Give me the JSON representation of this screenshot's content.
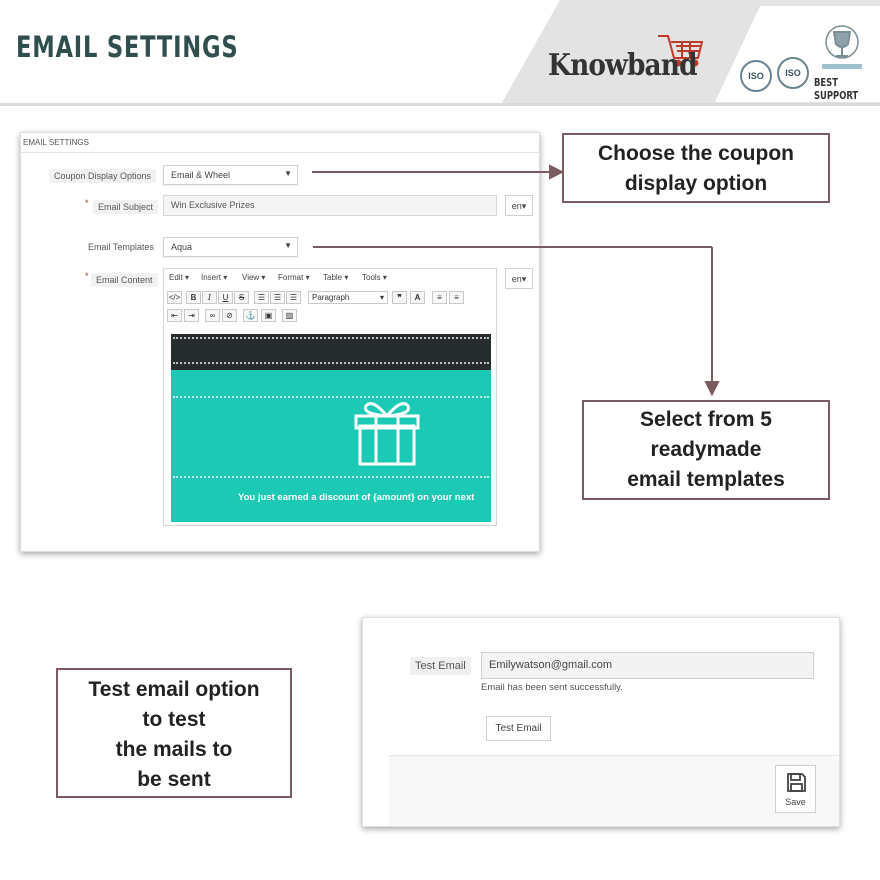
{
  "header": {
    "title": "EMAIL SETTINGS",
    "logo": "Knowband",
    "cert1": "ISO",
    "cert2": "ISO",
    "best_support": "BEST SUPPORT"
  },
  "panel1": {
    "title": "EMAIL SETTINGS",
    "coupon_label": "Coupon Display Options",
    "coupon_value": "Email & Wheel",
    "subject_label": "Email Subject",
    "subject_value": "Win Exclusive Prizes",
    "lang1": "en",
    "templates_label": "Email Templates",
    "templates_value": "Aqua",
    "content_label": "Email Content",
    "lang2": "en",
    "required_mark": "*",
    "editor": {
      "menu": [
        "Edit",
        "Insert",
        "View",
        "Format",
        "Table",
        "Tools"
      ],
      "paragraph": "Paragraph"
    },
    "preview_text": "You just earned a discount of {amount} on your next"
  },
  "callouts": {
    "coupon": [
      "Choose the coupon",
      "display option"
    ],
    "templates": [
      "Select from 5",
      "readymade",
      "email templates"
    ],
    "test": [
      "Test email option",
      "to test",
      "the mails to",
      "be sent"
    ]
  },
  "panel2": {
    "test_email_label": "Test Email",
    "test_email_value": "Emilywatson@gmail.com",
    "sent_message": "Email has been sent successfully.",
    "test_email_button": "Test Email",
    "save_button": "Save"
  },
  "colors": {
    "accent_teal": "#1bc9b4",
    "preview_dark": "#262b2e",
    "callout_border": "#7b5a60",
    "arrow": "#7b5a60"
  }
}
